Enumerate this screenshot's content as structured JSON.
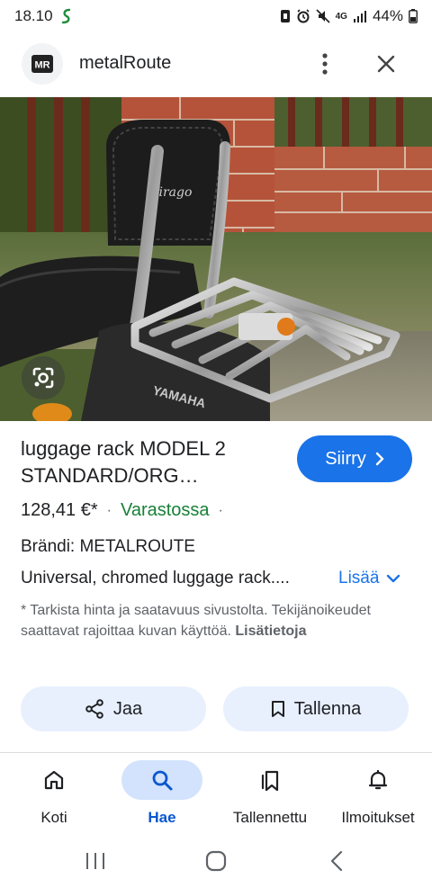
{
  "status_bar": {
    "time": "18.10",
    "battery": "44%",
    "network": "4G"
  },
  "header": {
    "site_name": "metalRoute",
    "logo_text": "MR"
  },
  "product": {
    "title": "luggage rack MODEL 2 STANDARD/ORG…",
    "go_button": "Siirry",
    "price": "128,41 €*",
    "stock": "Varastossa",
    "brand": "Brändi: METALROUTE",
    "description": "Universal, chromed luggage rack....",
    "more_label": "Lisää",
    "disclaimer": "* Tarkista hinta ja saatavuus sivustolta. Tekijänoikeudet saattavat rajoittaa kuvan käyttöä.",
    "info_link": "Lisätietoja",
    "image_emblem_text": "Virago",
    "image_tank_text": "YAMAHA"
  },
  "actions": {
    "share_label": "Jaa",
    "save_label": "Tallenna"
  },
  "bottom_nav": [
    {
      "label": "Koti",
      "icon": "home-icon",
      "active": false
    },
    {
      "label": "Hae",
      "icon": "search-icon",
      "active": true
    },
    {
      "label": "Tallennettu",
      "icon": "saved-icon",
      "active": false
    },
    {
      "label": "Ilmoitukset",
      "icon": "bell-icon",
      "active": false
    }
  ],
  "colors": {
    "accent": "#1a73e8",
    "stock_green": "#188038",
    "chip_bg": "#e8f0fe",
    "nav_active_bg": "#d3e3fd"
  }
}
